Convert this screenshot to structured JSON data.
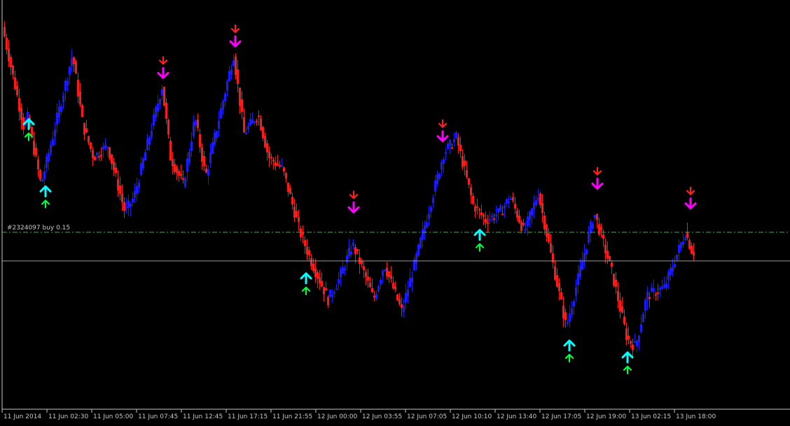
{
  "colors": {
    "background": "#000000",
    "bull_candle": "#1a1aff",
    "bear_candle": "#ff1a1a",
    "axis": "#c8c8c8",
    "order_line": "#3cb043",
    "buy_arrow": "#00ffff",
    "buy_arrow_small": "#00ff40",
    "sell_arrow": "#ff00ff",
    "sell_arrow_small": "#ff2020"
  },
  "chart_data": {
    "type": "candlestick",
    "x_tick_labels": [
      "11 Jun 2014",
      "11 Jun 02:30",
      "11 Jun 05:00",
      "11 Jun 07:45",
      "11 Jun 12:45",
      "11 Jun 17:15",
      "11 Jun 21:55",
      "12 Jun 00:00",
      "12 Jun 03:55",
      "12 Jun 07:05",
      "12 Jun 10:10",
      "12 Jun 13:40",
      "12 Jun 17:05",
      "12 Jun 19:00",
      "13 Jun 02:15",
      "13 Jun 18:00"
    ],
    "ylim": [
      0,
      100
    ],
    "close_path": [
      [
        0,
        95
      ],
      [
        30,
        70
      ],
      [
        36,
        72
      ],
      [
        55,
        55
      ],
      [
        100,
        88
      ],
      [
        115,
        70
      ],
      [
        130,
        62
      ],
      [
        150,
        65
      ],
      [
        175,
        48
      ],
      [
        188,
        52
      ],
      [
        228,
        80
      ],
      [
        240,
        62
      ],
      [
        258,
        55
      ],
      [
        275,
        72
      ],
      [
        290,
        57
      ],
      [
        330,
        88
      ],
      [
        345,
        68
      ],
      [
        365,
        73
      ],
      [
        380,
        62
      ],
      [
        400,
        59
      ],
      [
        425,
        43
      ],
      [
        440,
        36
      ],
      [
        455,
        30
      ],
      [
        465,
        26
      ],
      [
        480,
        31
      ],
      [
        500,
        40
      ],
      [
        520,
        31
      ],
      [
        530,
        26
      ],
      [
        545,
        35
      ],
      [
        570,
        23
      ],
      [
        590,
        36
      ],
      [
        630,
        63
      ],
      [
        648,
        67
      ],
      [
        672,
        50
      ],
      [
        690,
        46
      ],
      [
        710,
        48
      ],
      [
        725,
        52
      ],
      [
        745,
        43
      ],
      [
        765,
        53
      ],
      [
        780,
        40
      ],
      [
        805,
        19
      ],
      [
        845,
        48
      ],
      [
        870,
        33
      ],
      [
        892,
        16
      ],
      [
        904,
        14
      ],
      [
        920,
        27
      ],
      [
        945,
        29
      ],
      [
        975,
        43
      ],
      [
        985,
        38
      ]
    ],
    "order_line": {
      "label": "#2324097 buy 0.15",
      "value": 43
    },
    "buy_signals": [
      {
        "x": 36,
        "y": 73
      },
      {
        "x": 60,
        "y": 56
      },
      {
        "x": 432,
        "y": 34
      },
      {
        "x": 680,
        "y": 45
      },
      {
        "x": 808,
        "y": 17
      },
      {
        "x": 891,
        "y": 14
      }
    ],
    "sell_signals": [
      {
        "x": 228,
        "y": 81
      },
      {
        "x": 331,
        "y": 89
      },
      {
        "x": 500,
        "y": 47
      },
      {
        "x": 627,
        "y": 65
      },
      {
        "x": 848,
        "y": 53
      },
      {
        "x": 981,
        "y": 48
      }
    ]
  }
}
